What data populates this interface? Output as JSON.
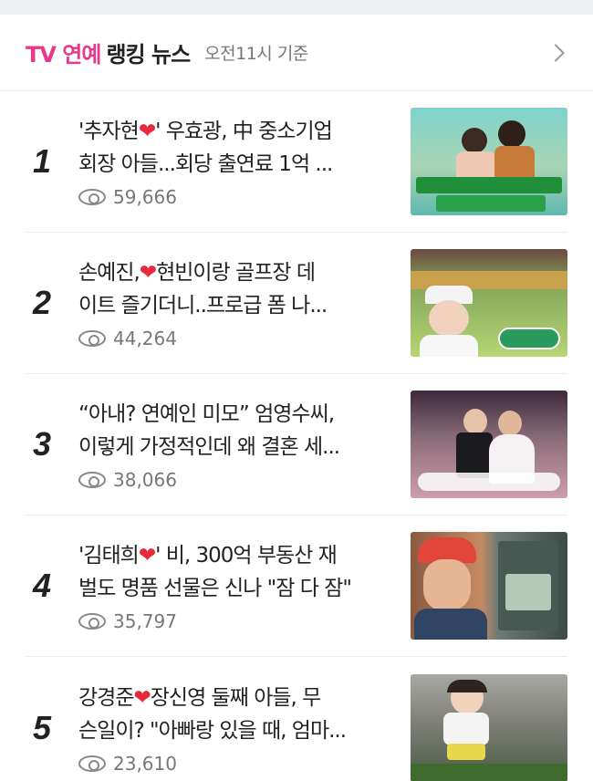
{
  "header": {
    "title_highlight": "TV 연예",
    "title_rest": "랭킹 뉴스",
    "subtitle": "오전11시 기준"
  },
  "items": [
    {
      "rank": "1",
      "line1_before": "'추자현",
      "line1_after": "' 우효광, 中 중소기업",
      "line2": "회장 아들...회당 출연료 1억 ...",
      "views": "59,666"
    },
    {
      "rank": "2",
      "line1_before": "손예진,",
      "line1_after": "현빈이랑 골프장 데",
      "line2": "이트 즐기더니..프로급 폼 나...",
      "views": "44,264"
    },
    {
      "rank": "3",
      "line1_before": "“아내? 연예인 미모” 엄영수씨,",
      "line1_after": "",
      "line2": "이렇게 가정적인데 왜 결혼 세...",
      "views": "38,066"
    },
    {
      "rank": "4",
      "line1_before": "'김태희",
      "line1_after": "' 비, 300억 부동산 재",
      "line2": "벌도 명품 선물은 신나 \"잠 다 잠\"",
      "views": "35,797"
    },
    {
      "rank": "5",
      "line1_before": "강경준",
      "line1_after": "장신영 둘째 아들, 무",
      "line2": "슨일이? \"아빠랑 있을 때, 엄마...",
      "views": "23,610"
    }
  ],
  "icons": {
    "heart": "❤",
    "views": "eye-icon",
    "more": "chevron-right-icon"
  },
  "colors": {
    "accent": "#e8398c",
    "heart": "#e8293b"
  }
}
